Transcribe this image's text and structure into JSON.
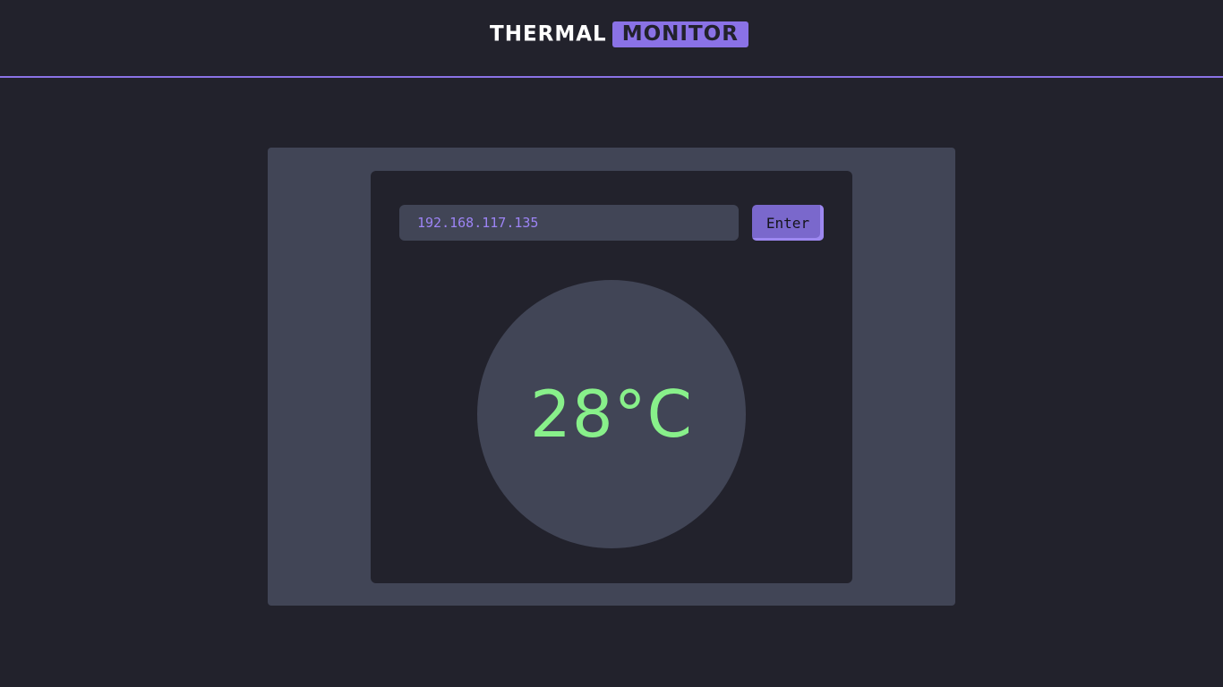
{
  "header": {
    "logo_part1": "THERMAL",
    "logo_part2": "MONITOR"
  },
  "device": {
    "ip_value": "192.168.117.135",
    "enter_label": "Enter"
  },
  "reading": {
    "temperature": "28°C"
  },
  "colors": {
    "background": "#22222c",
    "panel": "#414556",
    "accent": "#8a72e6",
    "temperature": "#88f08a"
  }
}
